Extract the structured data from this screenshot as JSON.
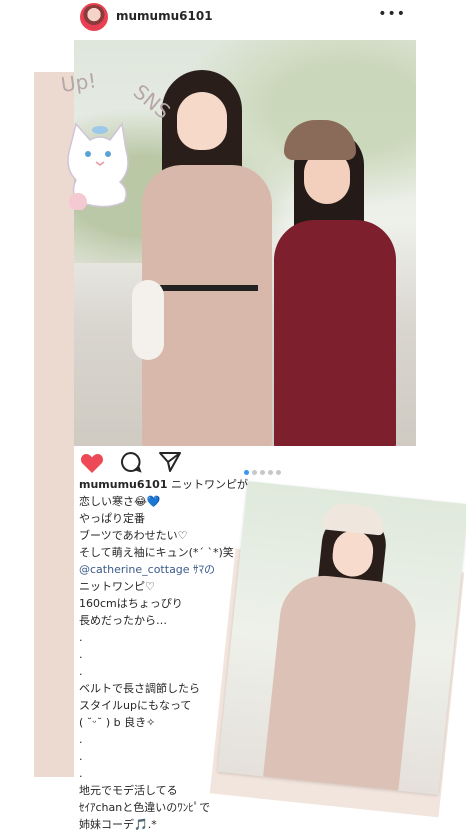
{
  "post": {
    "username": "mumumu6101",
    "more_icon": "more-horizontal-icon",
    "carousel_dots": 5,
    "carousel_active": 0
  },
  "decoration": {
    "title": "Pick Up! SNS",
    "accent_color": "#ecd9cf"
  },
  "actions": {
    "like_icon": "heart-icon",
    "comment_icon": "comment-icon",
    "share_icon": "share-icon",
    "like_color": "#ed4956"
  },
  "caption": {
    "username": "mumumu6101",
    "first_line": " ニットワンピが",
    "lines": [
      "恋しい寒さ😂💙",
      "やっぱり定番",
      "ブーツであわせたい♡",
      "そして萌え袖にキュン(*´ `*)笑",
      "@catherine_cottage ｻﾏの",
      "ニットワンピ♡",
      "160cmはちょっぴり",
      "長めだったから…",
      ".",
      ".",
      ".",
      "ベルトで長さ調節したら",
      "スタイルupにもなって",
      "( ˘ᵕ˘ ) b 良き✧",
      ".",
      ".",
      ".",
      "地元でモデ活してる",
      "ｾｲｱchanと色違いのﾜﾝﾋﾟで",
      "姉妹コーデ🎵.*"
    ]
  }
}
